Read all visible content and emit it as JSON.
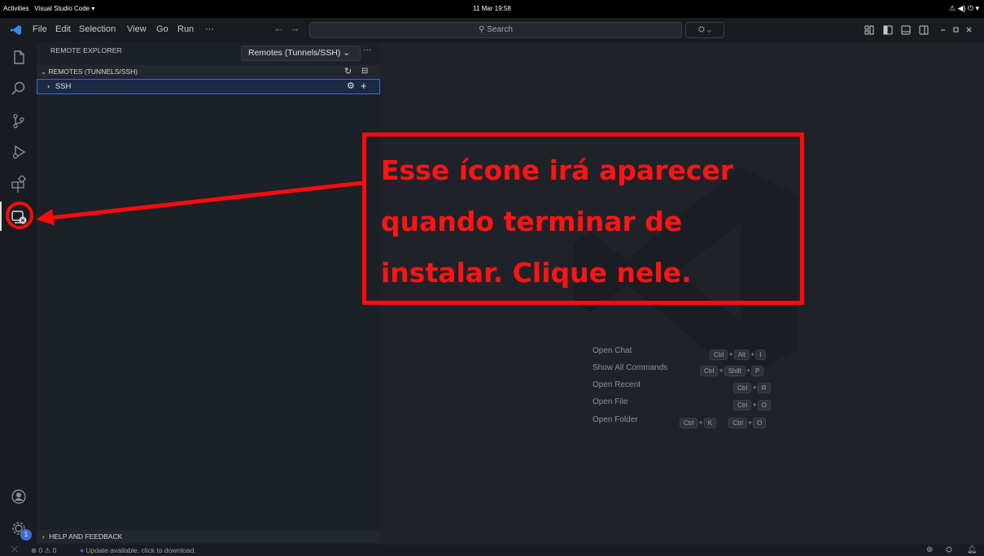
{
  "gnome": {
    "activities": "Activities",
    "app": "Visual Studio Code ▾",
    "clock": "11 Mar 19:58",
    "tray": "⚠ ◀) ⏻ ▾"
  },
  "menu": [
    "File",
    "Edit",
    "Selection",
    "View",
    "Go",
    "Run",
    "···"
  ],
  "search": {
    "placeholder": "Search"
  },
  "sidebar": {
    "title": "REMOTE EXPLORER",
    "dropdown": "Remotes (Tunnels/SSH)",
    "more": "···",
    "section": "REMOTES (TUNNELS/SSH)",
    "ssh_label": "SSH",
    "help": "HELP AND FEEDBACK"
  },
  "shortcuts": [
    {
      "label": "Open Chat",
      "keys": [
        [
          "Ctrl",
          "Alt",
          "I"
        ]
      ]
    },
    {
      "label": "Show All Commands",
      "keys": [
        [
          "Ctrl",
          "Shift",
          "P"
        ]
      ]
    },
    {
      "label": "Open Recent",
      "keys": [
        [
          "Ctrl",
          "R"
        ]
      ]
    },
    {
      "label": "Open File",
      "keys": [
        [
          "Ctrl",
          "O"
        ]
      ]
    },
    {
      "label": "Open Folder",
      "keys": [
        [
          "Ctrl",
          "K"
        ],
        [
          "Ctrl",
          "O"
        ]
      ]
    }
  ],
  "status": {
    "errors": "0",
    "warnings": "0",
    "update": "Update available, click to download."
  },
  "badge": "1",
  "annotation": {
    "line1": "Esse ícone irá aparecer",
    "line2": "quando terminar de",
    "line3": "instalar. Clique nele."
  },
  "colors": {
    "annotation": "#ff0b0b",
    "accent": "#3f6ad6"
  }
}
